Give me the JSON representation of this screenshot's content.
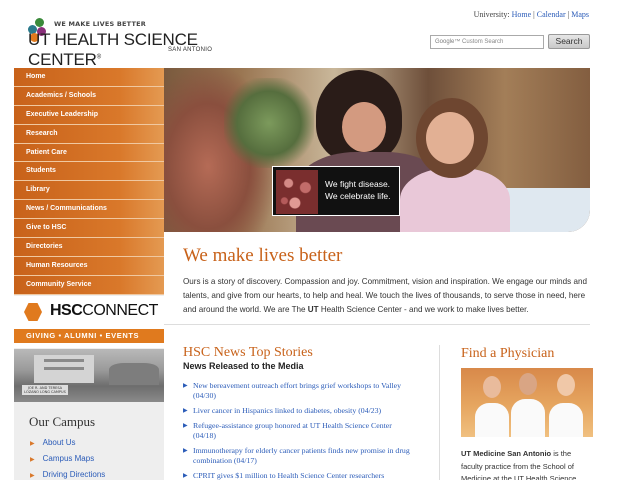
{
  "header": {
    "tagline": "WE MAKE LIVES BETTER",
    "brand_name": "UT HEALTH SCIENCE CENTER",
    "brand_sub": "SAN ANTONIO",
    "utility_label": "University:",
    "utility_links": [
      "Home",
      "Calendar",
      "Maps"
    ],
    "search_placeholder_brand": "Google",
    "search_placeholder": "Custom Search",
    "search_button": "Search"
  },
  "nav": {
    "items": [
      "Home",
      "Academics / Schools",
      "Executive Leadership",
      "Research",
      "Patient Care",
      "Students",
      "Library",
      "News / Communications",
      "Give to HSC",
      "Directories",
      "Human Resources",
      "Community Service"
    ]
  },
  "hsc_connect": {
    "name_bold": "HSC",
    "name_rest": "CONNECT",
    "bar": "GIVING  •  ALUMNI  •  EVENTS"
  },
  "campus_photo": {
    "sign": "JOE R. AND TERESA LOZANO LONG CAMPUS"
  },
  "campus": {
    "title": "Our Campus",
    "links": [
      "About Us",
      "Campus Maps",
      "Driving Directions"
    ]
  },
  "hero": {
    "card_line1": "We fight disease.",
    "card_line2": "We celebrate life."
  },
  "main": {
    "headline": "We make lives better",
    "intro_before": "Ours is a story of discovery. Compassion and joy. Commitment, vision and inspiration. We engage our minds and talents, and give from our hearts, to help and heal. We touch the lives of thousands, to serve those in need, here and around the world. We are The ",
    "intro_bold": "UT",
    "intro_after": " Health Science Center - and we work to make lives better."
  },
  "news": {
    "title": "HSC News Top Stories",
    "subtitle": "News Released to the Media",
    "items": [
      "New bereavement outreach effort brings grief workshops to Valley (04/30)",
      "Liver cancer in Hispanics linked to diabetes, obesity (04/23)",
      "Refugee-assistance group honored at UT Health Science Center (04/18)",
      "Immunotherapy for elderly cancer patients finds new promise in drug combination (04/17)",
      "CPRIT gives $1 million to Health Science Center researchers"
    ]
  },
  "physician": {
    "title": "Find a Physician",
    "text_bold": "UT Medicine San Antonio",
    "text_rest": " is the faculty practice from the School of Medicine at the UT Health Science"
  }
}
